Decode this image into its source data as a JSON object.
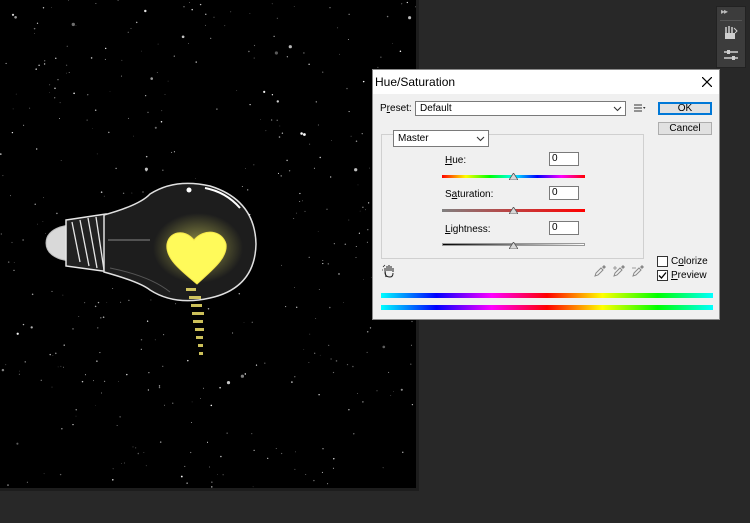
{
  "dialog": {
    "title": "Hue/Saturation",
    "preset_label": "Preset:",
    "preset_value": "Default",
    "ok_label": "OK",
    "cancel_label": "Cancel",
    "channel_value": "Master",
    "hue": {
      "label": "Hue:",
      "value": "0",
      "level": 0.5
    },
    "saturation": {
      "label": "Saturation:",
      "value": "0",
      "level": 0.5
    },
    "lightness": {
      "label": "Lightness:",
      "value": "0",
      "level": 0.5
    },
    "colorize_label": "Colorize",
    "colorize_checked": false,
    "preview_label": "Preview",
    "preview_checked": true
  },
  "icons": {
    "close": "close-icon",
    "preset_options": "preset-options-icon",
    "adjust_tool": "on-image-adjustment-hand-icon",
    "eyedroppers": [
      "eyedropper-icon",
      "eyedropper-plus-icon",
      "eyedropper-minus-icon"
    ],
    "panel": [
      "brush-tool-icon",
      "adjustments-icon"
    ]
  },
  "colors": {
    "ok_focus": "#0078d7",
    "bulb_glow": "#fffe6a",
    "canvas": "#000000",
    "workspace": "#282828"
  }
}
